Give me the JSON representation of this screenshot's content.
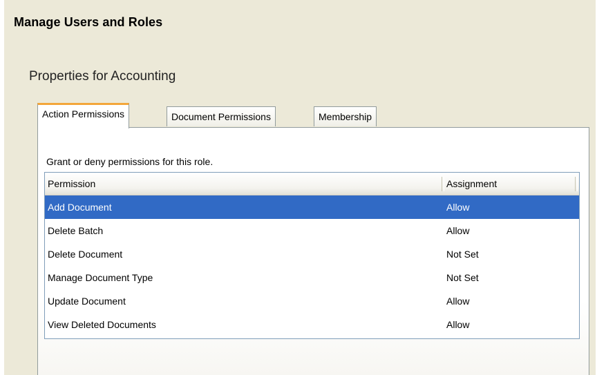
{
  "header": {
    "title": "Manage Users and Roles"
  },
  "properties": {
    "title": "Properties for Accounting"
  },
  "tabs": [
    {
      "label": "Action Permissions",
      "active": true
    },
    {
      "label": "Document Permissions",
      "active": false
    },
    {
      "label": "Membership",
      "active": false
    }
  ],
  "panel": {
    "description": "Grant or deny permissions for this role."
  },
  "table": {
    "columns": [
      "Permission",
      "Assignment"
    ],
    "rows": [
      {
        "permission": "Add Document",
        "assignment": "Allow",
        "selected": true
      },
      {
        "permission": "Delete Batch",
        "assignment": "Allow",
        "selected": false
      },
      {
        "permission": "Delete Document",
        "assignment": "Not Set",
        "selected": false
      },
      {
        "permission": "Manage Document Type",
        "assignment": "Not Set",
        "selected": false
      },
      {
        "permission": "Update Document",
        "assignment": "Allow",
        "selected": false
      },
      {
        "permission": "View Deleted Documents",
        "assignment": "Allow",
        "selected": false
      }
    ]
  },
  "colors": {
    "window_bg": "#ece9d8",
    "selection": "#316ac5",
    "active_tab_accent": "#f3a63a",
    "grid_border": "#7f9db9"
  }
}
